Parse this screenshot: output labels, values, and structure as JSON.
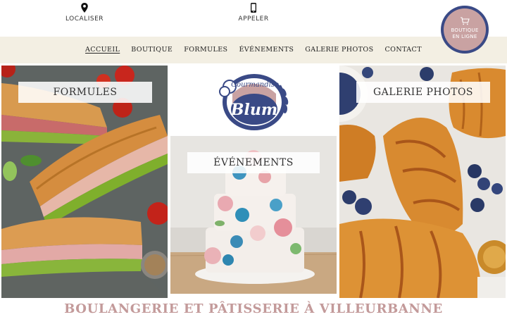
{
  "topbar": {
    "locate_label": "LOCALISER",
    "call_label": "APPELER",
    "shop_label_line1": "BOUTIQUE",
    "shop_label_line2": "EN LIGNE"
  },
  "nav": {
    "items": [
      "ACCUEIL",
      "BOUTIQUE",
      "FORMULES",
      "ÉVÉNEMENTS",
      "GALERIE PHOTOS",
      "CONTACT"
    ],
    "active": "ACCUEIL"
  },
  "logo": {
    "small_text": "Gourmandise",
    "brand": "Blum"
  },
  "panels": {
    "formules": "FORMULES",
    "evenements": "ÉVÉNEMENTS",
    "galerie": "GALERIE PHOTOS"
  },
  "footer": {
    "title": "BOULANGERIE ET PÂTISSERIE À VILLEURBANNE"
  },
  "colors": {
    "nav_bg": "#f3efe3",
    "badge_ring": "#3a4a86",
    "badge_fill": "#c9a2a2",
    "title_rose": "#c39a9a"
  }
}
